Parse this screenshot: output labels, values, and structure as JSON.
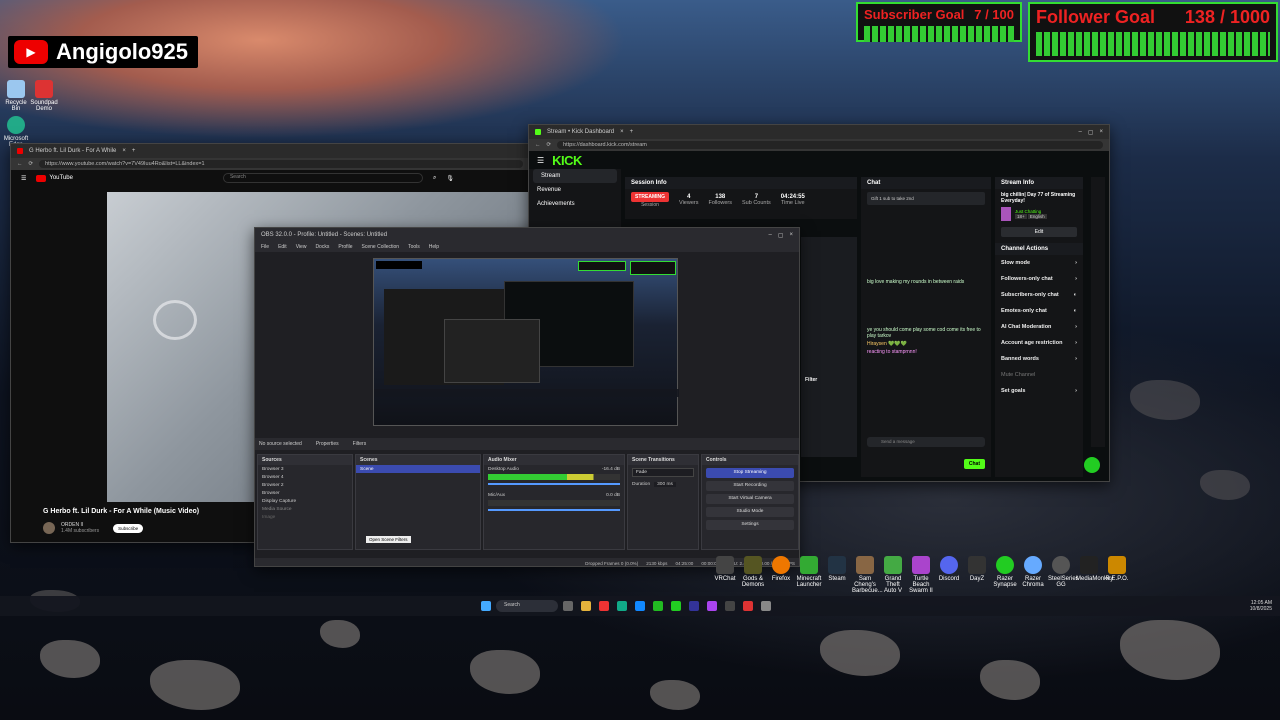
{
  "channel": {
    "name": "Angigolo925"
  },
  "goals": {
    "subscriber": {
      "label": "Subscriber Goal",
      "progress": "7 / 100",
      "current": 7,
      "target": 100
    },
    "follower": {
      "label": "Follower Goal",
      "progress": "138 / 1000",
      "current": 138,
      "target": 1000
    }
  },
  "desktop_icons_left": [
    "Recycle Bin",
    "Soundpad Demo",
    "Microsoft Edge"
  ],
  "youtube": {
    "tab_title": "G Herbo ft. Lil Durk - For A While",
    "url": "https://www.youtube.com/watch?v=7V49Iuu4Ro&list=LL&index=1",
    "brand": "YouTube",
    "search_placeholder": "Search",
    "video_title": "G Herbo ft. Lil Durk - For A While (Music Video)",
    "channel_name": "ORDEN II",
    "subscribers": "1.4M subscribers",
    "subscribe": "Subscribe"
  },
  "kick": {
    "tab_title": "Stream • Kick Dashboard",
    "url": "https://dashboard.kick.com/stream",
    "logo": "KICK",
    "nav": [
      "Stream",
      "Revenue",
      "Achievements"
    ],
    "session_info": {
      "title": "Session Info",
      "status": "STREAMING",
      "status_sub": "Session",
      "stats": [
        {
          "value": "4",
          "label": "Viewers"
        },
        {
          "value": "138",
          "label": "Followers"
        },
        {
          "value": "7",
          "label": "Sub Counts"
        },
        {
          "value": "04:24:55",
          "label": "Time Live"
        }
      ]
    },
    "chat": {
      "title": "Chat",
      "pinned": "Gift 1 sub to take 2nd",
      "messages": [
        "big love making my rounds in between raids",
        "ye you should come play some cod come its free to play tarkov",
        "Hiraysen 💚💚💚",
        "reacting to stamprnnn!"
      ],
      "input_placeholder": "Send a message",
      "send": "Chat"
    },
    "stream_info": {
      "title": "Stream Info",
      "stream_title": "big chillin| Day 77 of Streaming Everyday!",
      "category": "Just Chatting",
      "tags": [
        "18+",
        "English"
      ],
      "edit": "Edit"
    },
    "channel_actions": {
      "title": "Channel Actions",
      "items": [
        "Slow mode",
        "Followers-only chat",
        "Subscribers-only chat",
        "Emotes-only chat",
        "AI Chat Moderation",
        "Account age restriction",
        "Banned words",
        "Mute Channel",
        "Set goals"
      ]
    },
    "filter": "Filter"
  },
  "obs": {
    "title": "OBS 32.0.0 - Profile: Untitled - Scenes: Untitled",
    "menu": [
      "File",
      "Edit",
      "View",
      "Docks",
      "Profile",
      "Scene Collection",
      "Tools",
      "Help"
    ],
    "no_source": "No source selected",
    "properties": "Properties",
    "filters": "Filters",
    "docks": {
      "sources": {
        "title": "Sources",
        "items": [
          "Browser 3",
          "Browser 4",
          "Browser 2",
          "Browser",
          "Display Capture",
          "Media Source",
          "Image"
        ]
      },
      "scenes": {
        "title": "Scenes",
        "items": [
          "Scene"
        ]
      },
      "audio": {
        "title": "Audio Mixer",
        "channels": [
          {
            "name": "Desktop Audio",
            "level": "-16.4 dB"
          },
          {
            "name": "Mic/Aux",
            "level": "0.0 dB"
          }
        ]
      },
      "transitions": {
        "title": "Scene Transitions",
        "type": "Fade",
        "duration_label": "Duration",
        "duration": "300 ms"
      },
      "controls": {
        "title": "Controls",
        "buttons": [
          "Stop Streaming",
          "Start Recording",
          "Start Virtual Camera",
          "Studio Mode",
          "Settings"
        ]
      }
    },
    "status": {
      "dropped": "Dropped Frames 0 (0.0%)",
      "kbps": "2130 kbps",
      "live": "04:25:00",
      "rec": "00:00:00",
      "cpu": "CPU: 2.4%",
      "fps": "30.00 / 30.00 FPS"
    },
    "tooltip": "Open Scene Filters"
  },
  "taskbar": {
    "search": "Search",
    "time": "12:05 AM",
    "date": "10/8/2025"
  },
  "desktop_icons_right": [
    "VRChat",
    "Gods & Demons",
    "Firefox",
    "Minecraft Launcher",
    "Steam",
    "Sam Cheng's Barbecue...",
    "Grand Theft Auto V",
    "Turtle Beach Swarm II",
    "Discord",
    "DayZ",
    "Razer Synapse",
    "Razer Chroma",
    "SteelSeries GG",
    "MediaMonkey",
    "R.E.P.O."
  ]
}
